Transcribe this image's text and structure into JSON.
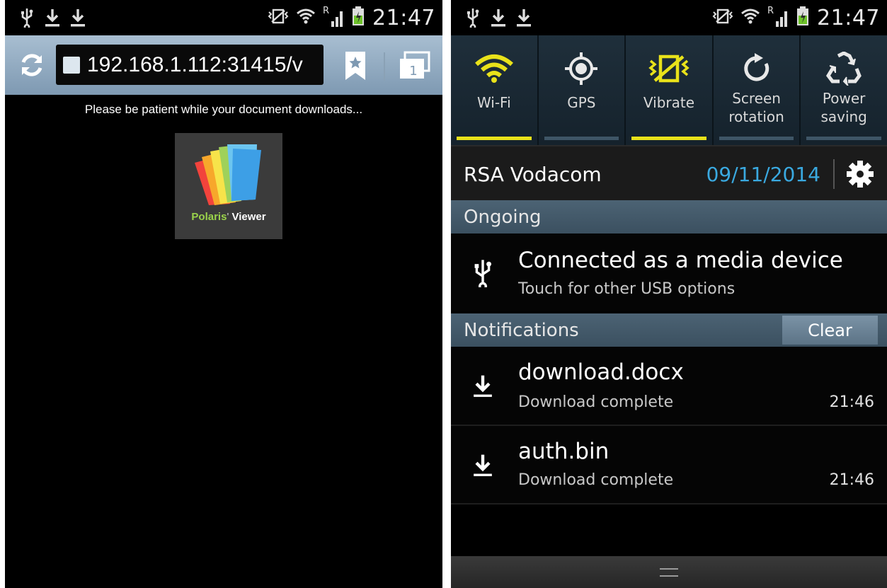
{
  "left_phone": {
    "status": {
      "time": "21:47",
      "roaming": "R"
    },
    "browser": {
      "url": "192.168.1.112:31415/v",
      "tab_count": "1",
      "message": "Please be patient while your document downloads...",
      "app_tile": {
        "label_part1": "Polaris",
        "label_mark": "'",
        "label_part2": " Viewer"
      }
    }
  },
  "right_phone": {
    "status": {
      "time": "21:47",
      "roaming": "R"
    },
    "quick_settings": [
      {
        "label": "Wi-Fi",
        "icon": "wifi-icon",
        "active": true
      },
      {
        "label": "GPS",
        "icon": "gps-icon",
        "active": false
      },
      {
        "label": "Vibrate",
        "icon": "vibrate-icon",
        "active": true
      },
      {
        "label": "Screen\nrotation",
        "icon": "rotate-icon",
        "active": false
      },
      {
        "label": "Power\nsaving",
        "icon": "recycle-icon",
        "active": false
      }
    ],
    "carrier": "RSA Vodacom",
    "date": "09/11/2014",
    "ongoing": {
      "header": "Ongoing",
      "title": "Connected as a media device",
      "subtitle": "Touch for other USB options"
    },
    "notifications": {
      "header": "Notifications",
      "clear_label": "Clear",
      "items": [
        {
          "title": "download.docx",
          "subtitle": "Download complete",
          "time": "21:46"
        },
        {
          "title": "auth.bin",
          "subtitle": "Download complete",
          "time": "21:46"
        }
      ]
    }
  },
  "colors": {
    "accent_blue": "#3aa9e0",
    "toggle_on": "#e9e21a",
    "polaris_green": "#9ad34b"
  }
}
